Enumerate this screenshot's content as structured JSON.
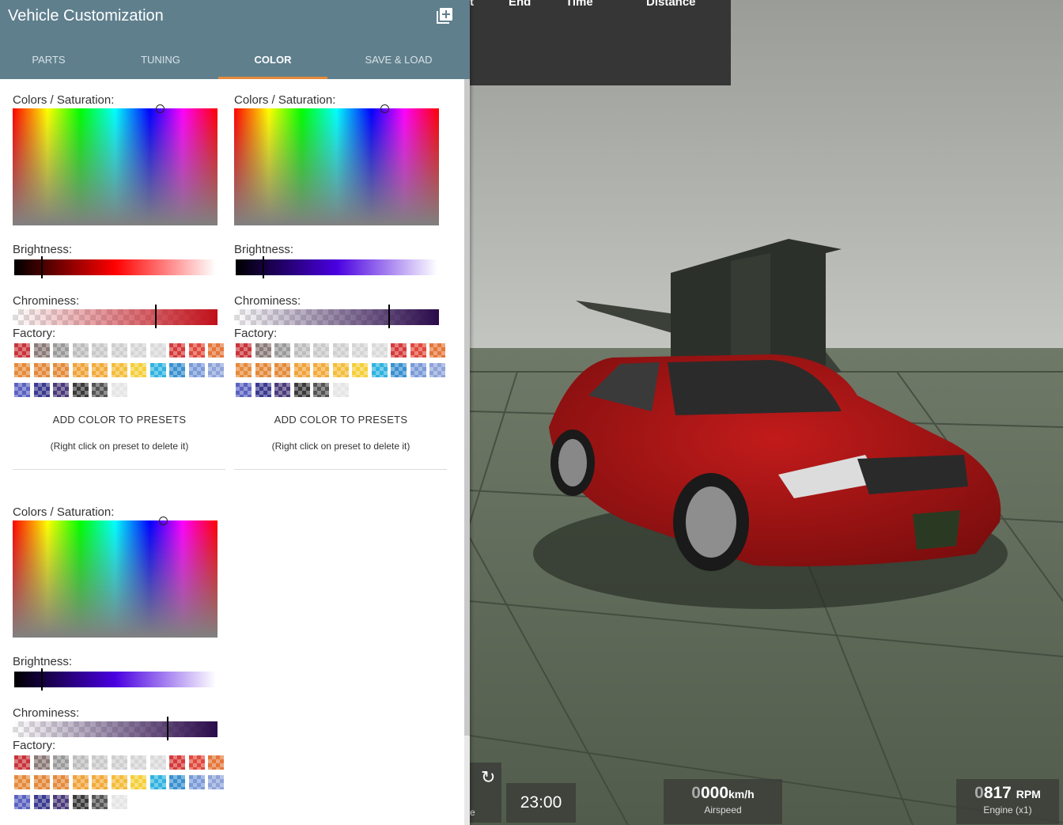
{
  "panel": {
    "title": "Vehicle Customization",
    "tabs": [
      {
        "label": "PARTS"
      },
      {
        "label": "TUNING"
      },
      {
        "label": "COLOR",
        "active": true
      },
      {
        "label": "SAVE & LOAD"
      }
    ],
    "accent_color": "#e58a3a",
    "header_color": "#5f7f8d"
  },
  "color_pickers": [
    {
      "sat_label": "Colors / Saturation:",
      "brightness_label": "Brightness:",
      "chroma_label": "Chrominess:",
      "factory_label": "Factory:",
      "add_button": "ADD COLOR TO PRESETS",
      "hint": "(Right click on preset to delete it)",
      "base_color": "#ff0000",
      "dark_color": "#c0101a",
      "hue_fraction": 0.72,
      "brightness_fraction": 0.14,
      "chroma_fraction": 0.7
    },
    {
      "sat_label": "Colors / Saturation:",
      "brightness_label": "Brightness:",
      "chroma_label": "Chrominess:",
      "factory_label": "Factory:",
      "add_button": "ADD COLOR TO PRESETS",
      "hint": "(Right click on preset to delete it)",
      "base_color": "#4a00e0",
      "dark_color": "#2a0a4a",
      "hue_fraction": 0.74,
      "brightness_fraction": 0.14,
      "chroma_fraction": 0.76
    },
    {
      "sat_label": "Colors / Saturation:",
      "brightness_label": "Brightness:",
      "chroma_label": "Chrominess:",
      "factory_label": "Factory:",
      "add_button": "",
      "hint": "",
      "base_color": "#4a00e0",
      "dark_color": "#2a0a4a",
      "hue_fraction": 0.74,
      "brightness_fraction": 0.14,
      "chroma_fraction": 0.76
    }
  ],
  "factory_colors": [
    "#c8343a",
    "#8a7a78",
    "#9a9a9a",
    "#bdbdbd",
    "#c9c9c9",
    "#cfcfcf",
    "#d5d5d5",
    "#dadada",
    "#d63a3a",
    "#e04a3c",
    "#e4773a",
    "#e58a3a",
    "#e3883a",
    "#e48a3a",
    "#f0a33a",
    "#f2ab3a",
    "#f4bd3a",
    "#f5cf3a",
    "#2fb3e0",
    "#3a90d0",
    "#7a9ad8",
    "#8ea3d8",
    "#5a62c0",
    "#3a3a90",
    "#4a3a7a",
    "#3a3a3a",
    "#555555",
    "#e5e5e5"
  ],
  "lap_table": {
    "headers": [
      "t",
      "End",
      "Time",
      "Distance"
    ]
  },
  "hud": {
    "reset_icon": "refresh-icon",
    "reset_label": "e",
    "clock": "23:00",
    "speed_dim": "0",
    "speed_value": "000",
    "speed_unit": "km/h",
    "speed_label": "Airspeed",
    "rpm_dim": "0",
    "rpm_value": "817",
    "rpm_unit": "RPM",
    "rpm_label": "Engine (x1)"
  }
}
